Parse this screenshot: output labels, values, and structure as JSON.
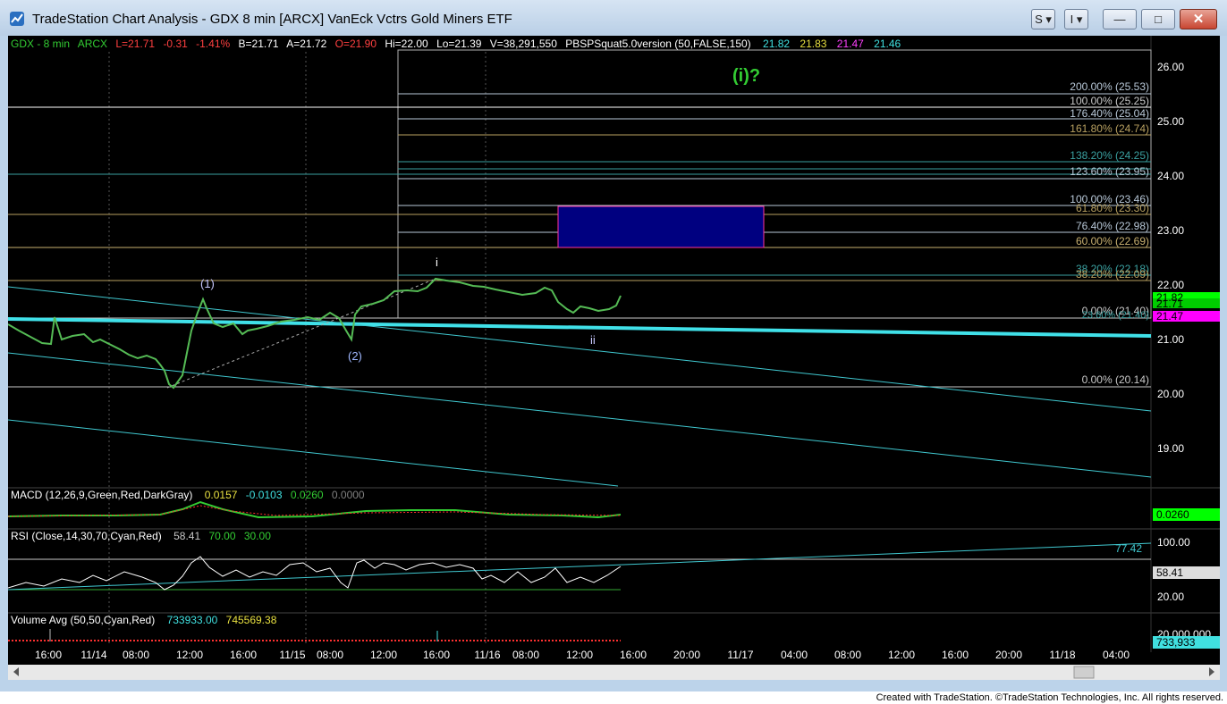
{
  "window": {
    "title": "TradeStation Chart Analysis - GDX 8 min [ARCX] VanEck Vctrs Gold Miners ETF",
    "buttons": {
      "s_label": "S",
      "i_label": "I",
      "minimize": "—",
      "maximize": "□",
      "close": "✕"
    }
  },
  "header": {
    "symbol": "GDX - 8 min",
    "exchange": "ARCX",
    "last": "L=21.71",
    "change": "-0.31",
    "change_pct": "-1.41%",
    "bid": "B=21.71",
    "ask": "A=21.72",
    "open": "O=21.90",
    "high": "Hi=22.00",
    "low": "Lo=21.39",
    "volume": "V=38,291,550",
    "indicator": "PBSPSquat5.0version (50,FALSE,150)",
    "ind_values": [
      "21.82",
      "21.83",
      "21.47",
      "21.46"
    ]
  },
  "price_axis": {
    "ticks": [
      "26.00",
      "25.00",
      "24.00",
      "23.00",
      "22.00",
      "21.00",
      "20.00",
      "19.00"
    ],
    "markers": [
      {
        "text": "21.82",
        "color": "#00ff00"
      },
      {
        "text": "21.71",
        "color": "#00cc00"
      },
      {
        "text": "21.47",
        "color": "#ff00ff"
      }
    ]
  },
  "wave_labels": {
    "w1": "(1)",
    "w2": "(2)",
    "wi": "i",
    "wii": "ii",
    "target": "(i)?"
  },
  "fib_labels": [
    {
      "text": "200.00% (25.53)",
      "color": "#b8c8d8"
    },
    {
      "text": "100.00% (25.25)",
      "color": "#c8c8c8"
    },
    {
      "text": "176.40% (25.04)",
      "color": "#b8c8d8"
    },
    {
      "text": "161.80% (24.74)",
      "color": "#b8a060"
    },
    {
      "text": "138.20% (24.25)",
      "color": "#3aa0a0"
    },
    {
      "text": "123.60% (23.95)",
      "color": "#b8c8d8"
    },
    {
      "text": "100.00% (23.46)",
      "color": "#b8c8d8"
    },
    {
      "text": "61.80% (23.30)",
      "color": "#b8a060"
    },
    {
      "text": "76.40% (22.98)",
      "color": "#b8c8d8"
    },
    {
      "text": "60.00% (22.69)",
      "color": "#c8b070"
    },
    {
      "text": "38.20% (22.18)",
      "color": "#3aa0a0"
    },
    {
      "text": "38.20% (22.09)",
      "color": "#b8a060"
    },
    {
      "text": "0.00% (21.40)",
      "color": "#c8c8c8"
    },
    {
      "text": "23.60% (21.40)",
      "color": "#3aa0a0"
    },
    {
      "text": "0.00% (20.14)",
      "color": "#c8c8c8"
    }
  ],
  "macd": {
    "label": "MACD (12,26,9,Green,Red,DarkGray)",
    "values": [
      "0.0157",
      "-0.0103",
      "0.0260",
      "0.0000"
    ],
    "marker": "0.0260"
  },
  "rsi": {
    "label": "RSI (Close,14,30,70,Cyan,Red)",
    "values": [
      "58.41",
      "70.00",
      "30.00"
    ],
    "ticks": [
      "100.00",
      "20.00"
    ],
    "marker": "58.41",
    "trend_label": "77.42"
  },
  "volume": {
    "label": "Volume Avg (50,50,Cyan,Red)",
    "values": [
      "733933.00",
      "745569.38"
    ],
    "tick": "20,000,000",
    "marker": "733,933"
  },
  "time_axis": [
    "16:00",
    "11/14",
    "08:00",
    "12:00",
    "16:00",
    "11/15",
    "08:00",
    "12:00",
    "16:00",
    "11/16",
    "08:00",
    "12:00",
    "16:00",
    "20:00",
    "11/17",
    "04:00",
    "08:00",
    "12:00",
    "16:00",
    "20:00",
    "11/18",
    "04:00"
  ],
  "footer": "Created with TradeStation. ©TradeStation Technologies, Inc. All rights reserved."
}
